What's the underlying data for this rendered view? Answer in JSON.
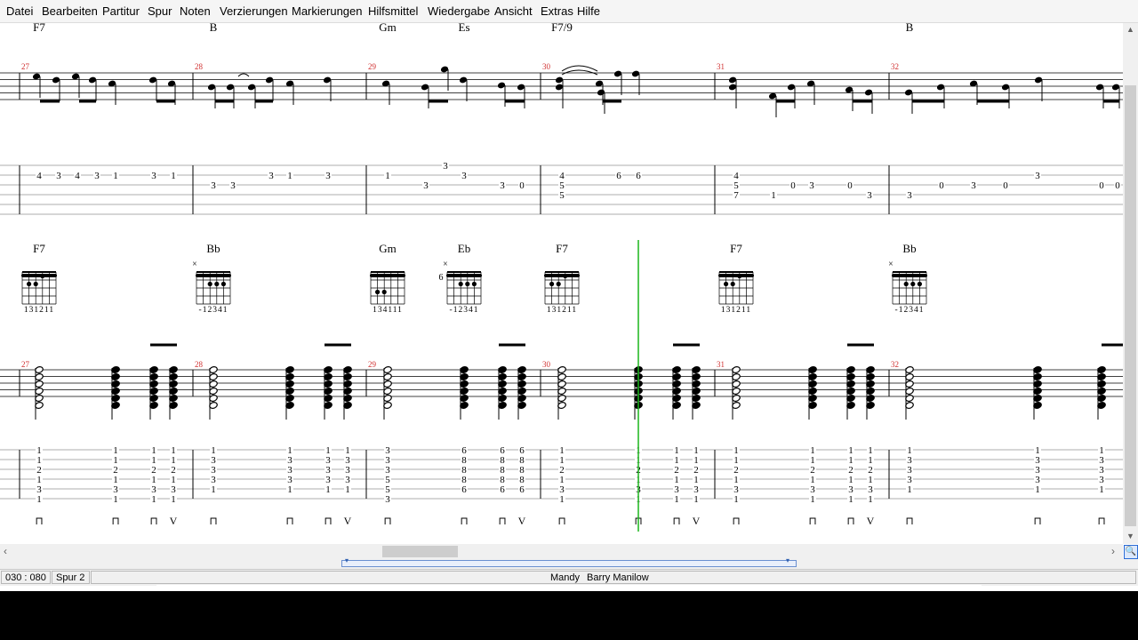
{
  "menu": {
    "items": [
      "Datei",
      "Bearbeiten",
      "Partitur",
      "Spur",
      "Noten",
      "Verzierungen",
      "Markierungen",
      "Hilfsmittel",
      "Wiedergabe",
      "Ansicht",
      "Extras",
      "Hilfe"
    ]
  },
  "score": {
    "system1": {
      "chord_names": [
        "F7",
        "B",
        "Gm",
        "Es",
        "F7/9",
        "B"
      ],
      "measure_numbers": [
        "27",
        "28",
        "29",
        "30",
        "31",
        "32"
      ],
      "tab_numbers": {
        "m27": [
          "4",
          "3",
          "4",
          "3",
          "1",
          "3",
          "1"
        ],
        "m28": [
          "3",
          "3",
          "3",
          "1",
          "3"
        ],
        "m29": [
          "1",
          "3",
          "3",
          "3",
          "3",
          "0"
        ],
        "m30": [
          "4",
          "5",
          "5",
          "6",
          "6"
        ],
        "m31": [
          "4",
          "5",
          "7",
          "1",
          "0",
          "3",
          "0",
          "3"
        ],
        "m32": [
          "3",
          "0",
          "3",
          "0",
          "3",
          "0",
          "0"
        ]
      }
    },
    "system2": {
      "chord_diagrams": [
        {
          "name": "F7",
          "fingering": "131211",
          "mute": "",
          "fret": ""
        },
        {
          "name": "Bb",
          "fingering": "-12341",
          "mute": "×",
          "fret": ""
        },
        {
          "name": "Gm",
          "fingering": "134111",
          "mute": "",
          "fret": ""
        },
        {
          "name": "Eb",
          "fingering": "-12341",
          "mute": "×",
          "fret": "6"
        },
        {
          "name": "F7",
          "fingering": "131211",
          "mute": "",
          "fret": ""
        },
        {
          "name": "F7",
          "fingering": "131211",
          "mute": "",
          "fret": ""
        },
        {
          "name": "Bb",
          "fingering": "-12341",
          "mute": "×",
          "fret": ""
        }
      ],
      "measure_numbers": [
        "27",
        "28",
        "29",
        "30",
        "31",
        "32"
      ],
      "tab_columns": [
        [
          "1",
          "1",
          "2",
          "1",
          "3",
          "1"
        ],
        [
          "1",
          "1",
          "2",
          "1",
          "3",
          "1"
        ],
        [
          "1",
          "1",
          "2",
          "1",
          "3",
          "1"
        ],
        [
          "1",
          "1",
          "2",
          "1",
          "3",
          "1"
        ],
        [
          "1",
          "3",
          "3",
          "3",
          "1"
        ],
        [
          "1",
          "3",
          "3",
          "3",
          "1"
        ],
        [
          "1",
          "3",
          "3",
          "3",
          "1"
        ],
        [
          "1",
          "3",
          "3",
          "3",
          "1"
        ],
        [
          "3",
          "3",
          "3",
          "5",
          "5",
          "3"
        ],
        [
          "6",
          "8",
          "8",
          "8",
          "6"
        ],
        [
          "6",
          "8",
          "8",
          "8",
          "6"
        ],
        [
          "6",
          "8",
          "8",
          "8",
          "6"
        ],
        [
          "1",
          "1",
          "2",
          "1",
          "3",
          "1"
        ],
        [
          "1",
          "1",
          "2",
          "1",
          "3",
          "1"
        ],
        [
          "1",
          "1",
          "2",
          "1",
          "3",
          "1"
        ],
        [
          "1",
          "1",
          "2",
          "1",
          "3",
          "1"
        ],
        [
          "1",
          "1",
          "2",
          "1",
          "3",
          "1"
        ],
        [
          "1",
          "1",
          "2",
          "1",
          "3",
          "1"
        ],
        [
          "1",
          "1",
          "2",
          "1",
          "3",
          "1"
        ],
        [
          "1",
          "1",
          "2",
          "1",
          "3",
          "1"
        ],
        [
          "1",
          "3",
          "3",
          "3",
          "1"
        ],
        [
          "1",
          "3",
          "3",
          "3",
          "1"
        ],
        [
          "1",
          "3",
          "3",
          "3",
          "1"
        ]
      ],
      "strum_symbols": {
        "down": "⊓",
        "up": "V"
      }
    },
    "colors": {
      "measure_number": "#d03030",
      "cursor": "#1bb51b",
      "staff": "#000000"
    }
  },
  "status": {
    "position": "030 : 080",
    "track": "Spur 2",
    "title": "Mandy",
    "artist": "Barry Manilow"
  },
  "icons": {
    "scroll_left": "◀",
    "scroll_right": "▶",
    "scroll_up": "▲",
    "scroll_down": "▼",
    "zoom": "magnifier-icon"
  }
}
